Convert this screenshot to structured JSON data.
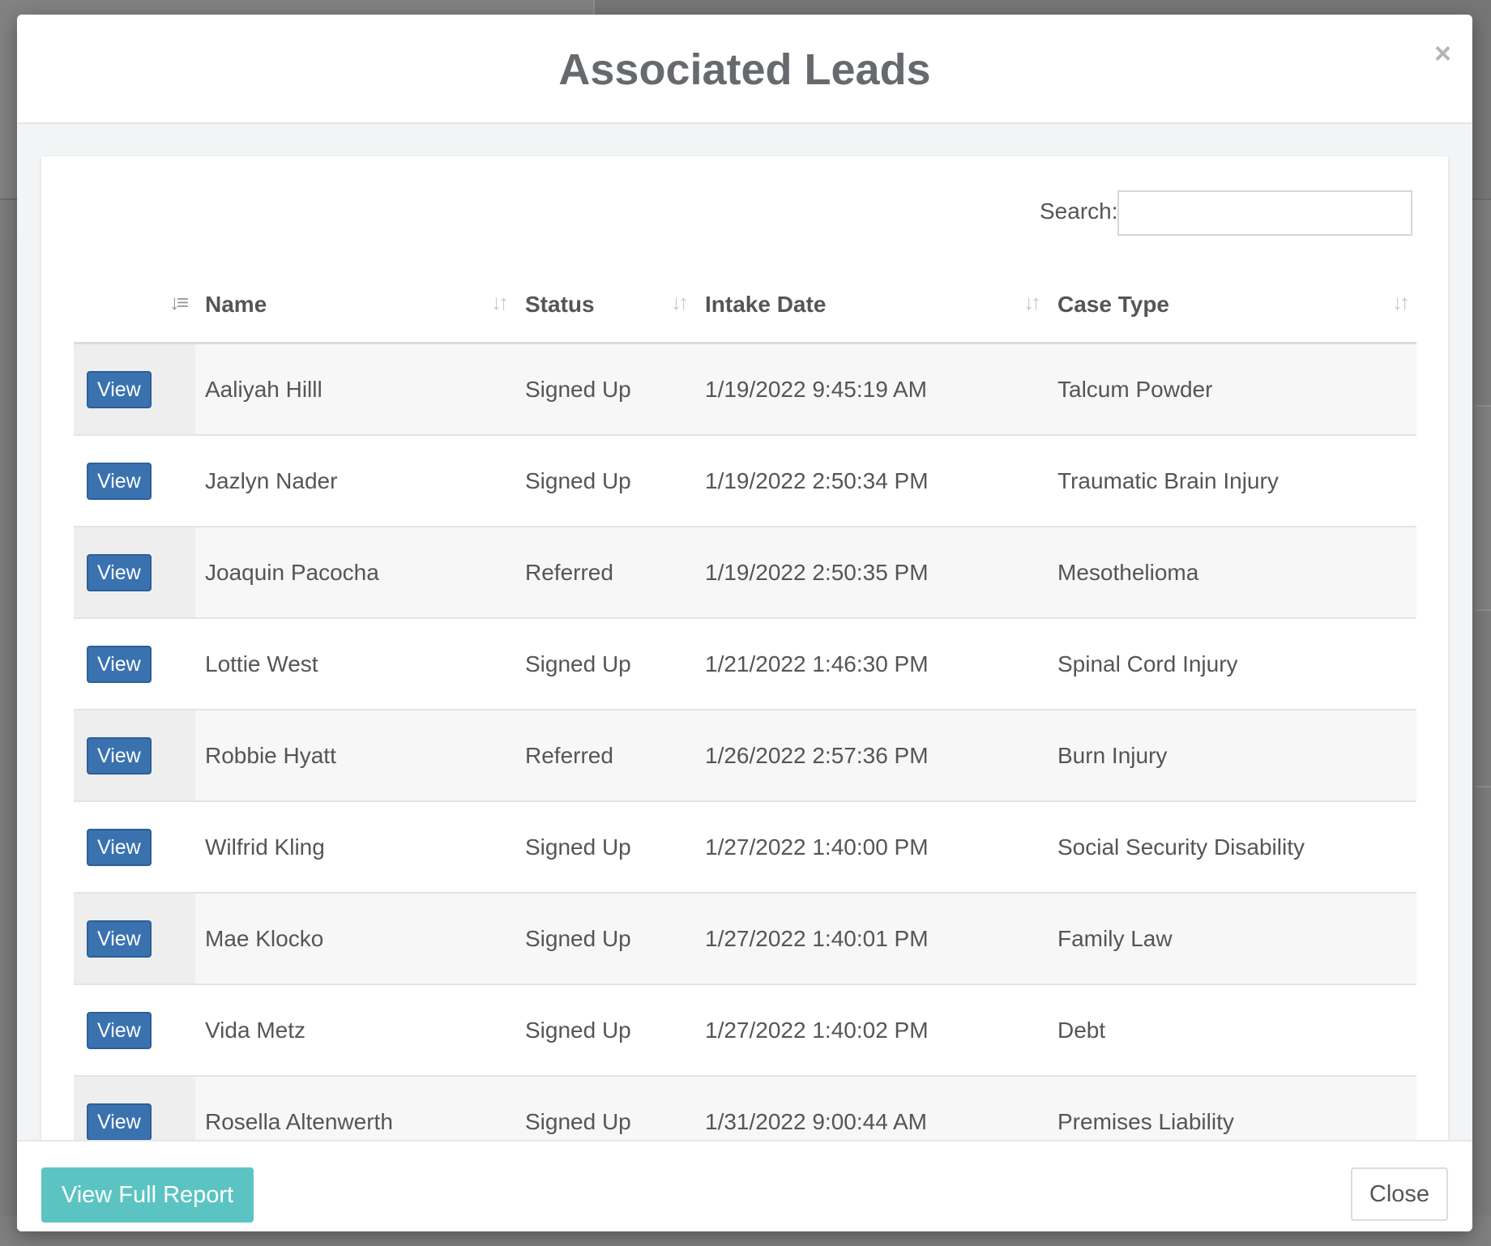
{
  "modal": {
    "title": "Associated Leads",
    "close_icon": "×"
  },
  "search": {
    "label": "Search:",
    "value": "",
    "placeholder": ""
  },
  "table": {
    "columns": [
      "",
      "Name",
      "Status",
      "Intake Date",
      "Case Type"
    ],
    "sort_icon": "sort-icon",
    "view_label": "View",
    "rows": [
      {
        "name": "Aaliyah Hilll",
        "status": "Signed Up",
        "intake_date": "1/19/2022 9:45:19 AM",
        "case_type": "Talcum Powder"
      },
      {
        "name": "Jazlyn Nader",
        "status": "Signed Up",
        "intake_date": "1/19/2022 2:50:34 PM",
        "case_type": "Traumatic Brain Injury"
      },
      {
        "name": "Joaquin Pacocha",
        "status": "Referred",
        "intake_date": "1/19/2022 2:50:35 PM",
        "case_type": "Mesothelioma"
      },
      {
        "name": "Lottie West",
        "status": "Signed Up",
        "intake_date": "1/21/2022 1:46:30 PM",
        "case_type": "Spinal Cord Injury"
      },
      {
        "name": "Robbie Hyatt",
        "status": "Referred",
        "intake_date": "1/26/2022 2:57:36 PM",
        "case_type": "Burn Injury"
      },
      {
        "name": "Wilfrid Kling",
        "status": "Signed Up",
        "intake_date": "1/27/2022 1:40:00 PM",
        "case_type": "Social Security Disability"
      },
      {
        "name": "Mae Klocko",
        "status": "Signed Up",
        "intake_date": "1/27/2022 1:40:01 PM",
        "case_type": "Family Law"
      },
      {
        "name": "Vida Metz",
        "status": "Signed Up",
        "intake_date": "1/27/2022 1:40:02 PM",
        "case_type": "Debt"
      },
      {
        "name": "Rosella Altenwerth",
        "status": "Signed Up",
        "intake_date": "1/31/2022 9:00:44 AM",
        "case_type": "Premises Liability"
      }
    ]
  },
  "footer": {
    "report_label": "View Full Report",
    "close_label": "Close"
  },
  "colors": {
    "view_button": "#3a72b0",
    "report_button": "#5bc4c3",
    "overlay": "#7b7b7b"
  }
}
